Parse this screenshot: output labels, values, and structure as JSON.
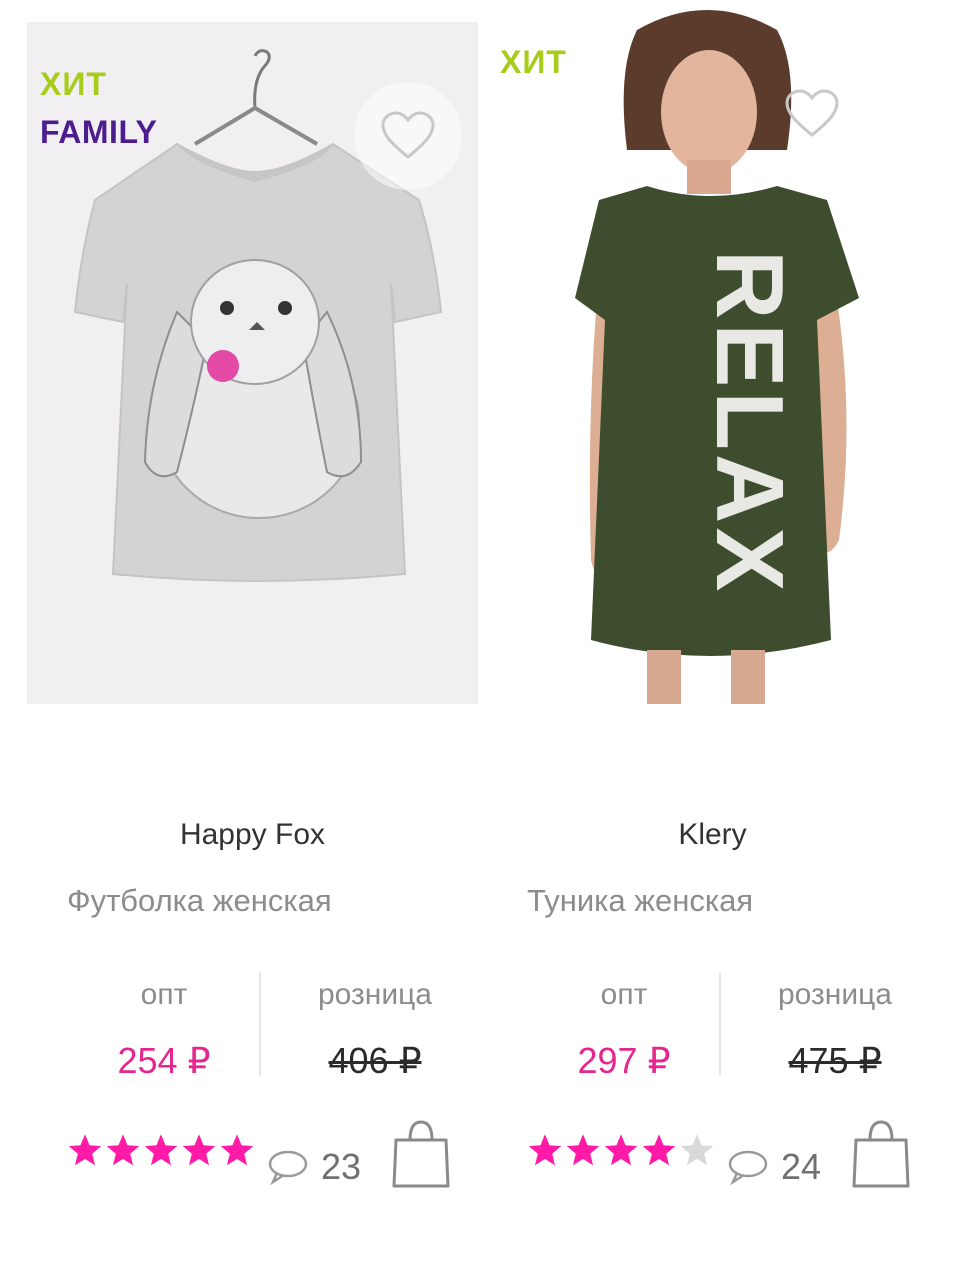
{
  "products": [
    {
      "badges": [
        "ХИТ",
        "FAMILY"
      ],
      "brand": "Happy Fox",
      "type": "Футболка женская",
      "opt_label": "опт",
      "opt_price": "254 ₽",
      "retail_label": "розница",
      "retail_price": "406 ₽",
      "rating": 5,
      "comments": "23",
      "image": "grey t-shirt with bunny print on hanger"
    },
    {
      "badges": [
        "ХИТ"
      ],
      "brand": "Klery",
      "type": "Туника женская",
      "opt_label": "опт",
      "opt_price": "297 ₽",
      "retail_label": "розница",
      "retail_price": "475 ₽",
      "rating": 4,
      "comments": "24",
      "image": "woman in dark green tunic dress with RELAX print"
    }
  ],
  "colors": {
    "hit_badge": "#a8cc1a",
    "family_badge": "#4b1d8f",
    "price_accent": "#e5268e",
    "star_active": "#ff1aa8",
    "star_inactive": "#d9d9d9"
  },
  "icons": {
    "favorite": "heart-icon",
    "comments": "speech-bubble-icon",
    "cart": "shopping-bag-icon",
    "rating": "star-icon"
  }
}
